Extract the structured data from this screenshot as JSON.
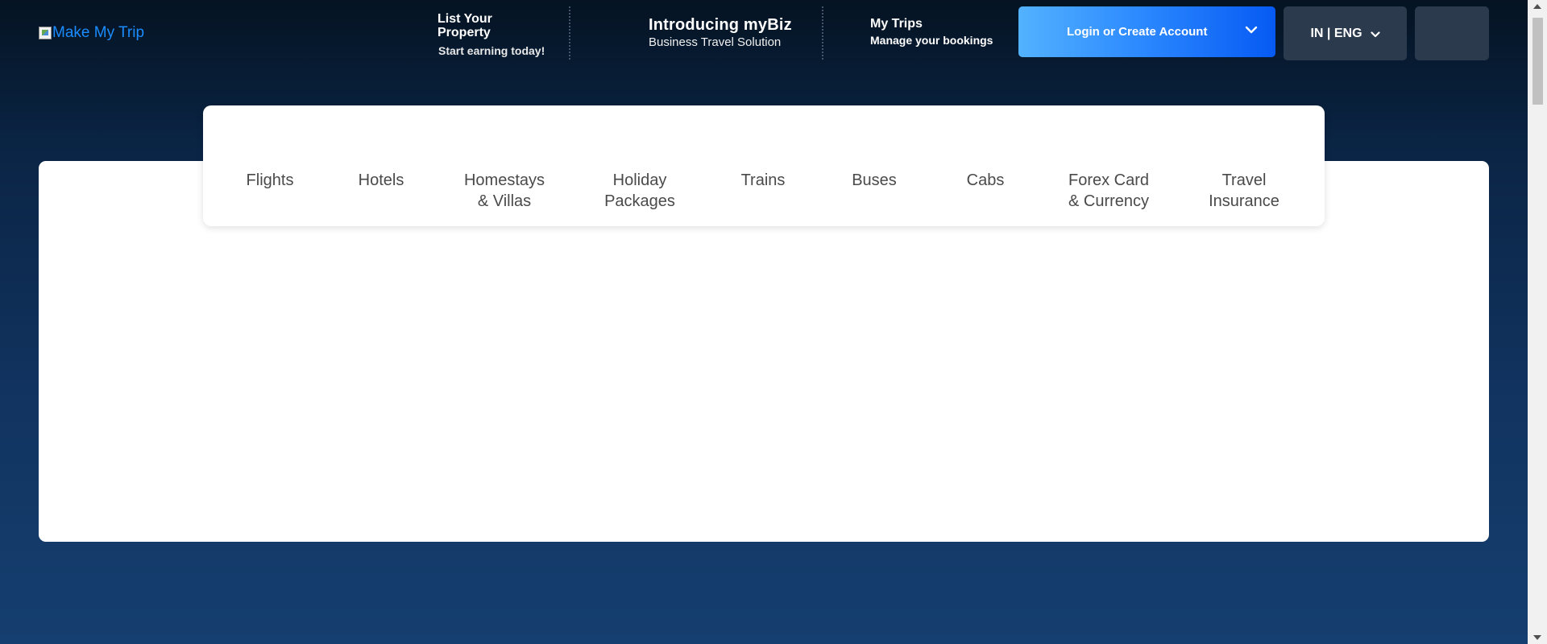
{
  "header": {
    "logo_alt": "Make My Trip",
    "list_property": {
      "title": "List Your Property",
      "subtitle": "Start earning today!"
    },
    "mybiz": {
      "title": "Introducing myBiz",
      "subtitle": "Business Travel Solution"
    },
    "my_trips": {
      "title": "My Trips",
      "subtitle": "Manage your bookings"
    },
    "login_label": "Login or Create Account",
    "language_label": "IN | ENG"
  },
  "nav": {
    "items": [
      {
        "line1": "Flights",
        "line2": ""
      },
      {
        "line1": "Hotels",
        "line2": ""
      },
      {
        "line1": "Homestays",
        "line2": "& Villas"
      },
      {
        "line1": "Holiday",
        "line2": "Packages"
      },
      {
        "line1": "Trains",
        "line2": ""
      },
      {
        "line1": "Buses",
        "line2": ""
      },
      {
        "line1": "Cabs",
        "line2": ""
      },
      {
        "line1": "Forex Card",
        "line2": "& Currency"
      },
      {
        "line1": "Travel",
        "line2": "Insurance"
      }
    ]
  },
  "colors": {
    "background_top": "#051322",
    "background_bottom": "#153f70",
    "login_gradient_start": "#53b2fe",
    "login_gradient_end": "#065af3",
    "link_blue": "#1a8cff"
  },
  "icons": {
    "login_dropdown": "chevron-down-icon",
    "language_dropdown": "chevron-down-icon",
    "logo": "broken-image-icon"
  }
}
